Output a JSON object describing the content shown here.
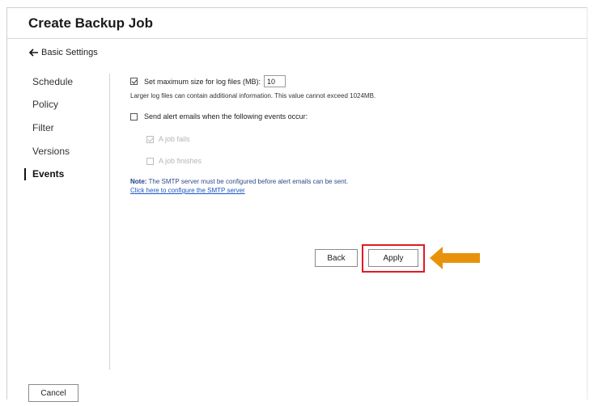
{
  "title": "Create Backup Job",
  "back_label": "Basic Settings",
  "nav": {
    "items": [
      {
        "label": "Schedule"
      },
      {
        "label": "Policy"
      },
      {
        "label": "Filter"
      },
      {
        "label": "Versions"
      },
      {
        "label": "Events"
      }
    ],
    "active": "Events"
  },
  "events": {
    "max_log": {
      "label": "Set maximum size for log files (MB):",
      "value": "10",
      "checked": true
    },
    "max_log_help": "Larger log files can contain additional information. This value cannot exceed 1024MB.",
    "alert": {
      "label": "Send alert emails when the following events occur:",
      "checked": false
    },
    "job_fails": {
      "label": "A job fails",
      "checked": true,
      "disabled": true
    },
    "job_finishes": {
      "label": "A job finishes",
      "checked": false,
      "disabled": true
    },
    "note_prefix": "Note:",
    "note_text": " The SMTP server must be configured before alert emails can be sent.",
    "smtp_link": "Click here to configure the SMTP server"
  },
  "buttons": {
    "back": "Back",
    "apply": "Apply",
    "cancel": "Cancel"
  },
  "annotation": {
    "highlight_color": "#e21a22",
    "arrow_color": "#e8920c"
  }
}
